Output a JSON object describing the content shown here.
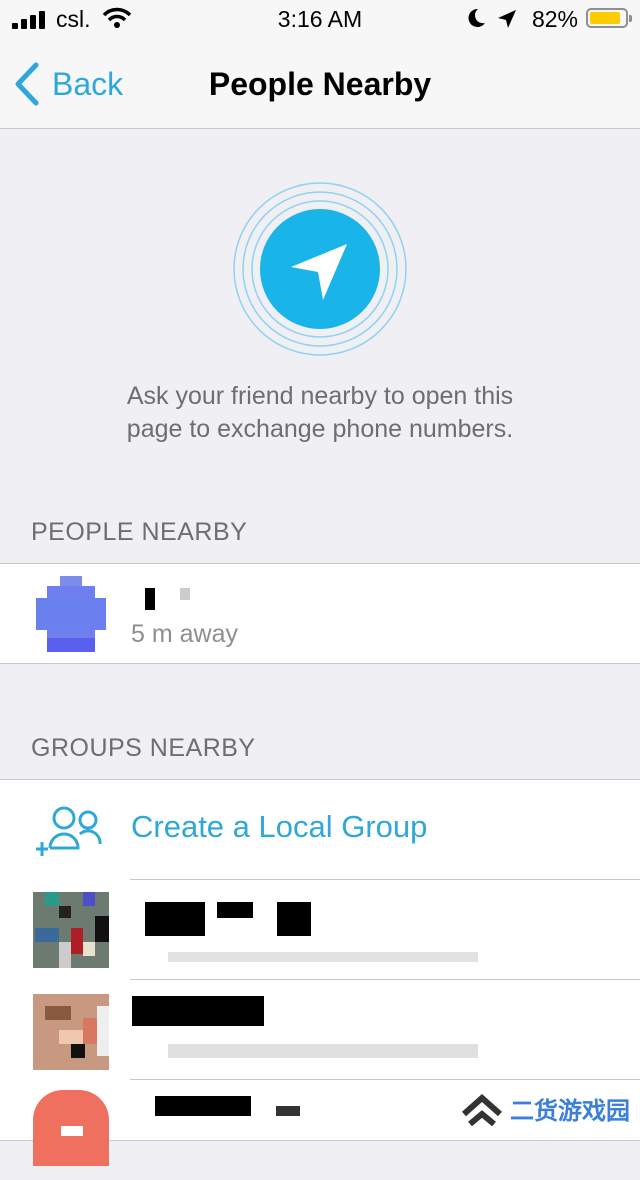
{
  "status": {
    "carrier": "csl.",
    "time": "3:16 AM",
    "battery": "82%"
  },
  "nav": {
    "back_label": "Back",
    "title": "People Nearby"
  },
  "intro": {
    "line1": "Ask your friend nearby to open this",
    "line2": "page to exchange phone numbers."
  },
  "people_section": {
    "header": "PEOPLE NEARBY",
    "items": [
      {
        "distance": "5 m away"
      }
    ]
  },
  "groups_section": {
    "header": "GROUPS NEARBY",
    "create_label": "Create a Local Group"
  },
  "watermark": {
    "text": "二货游戏园"
  },
  "colors": {
    "accent": "#2fa8d9",
    "background": "#efeff4",
    "battery": "#ffcc00"
  }
}
